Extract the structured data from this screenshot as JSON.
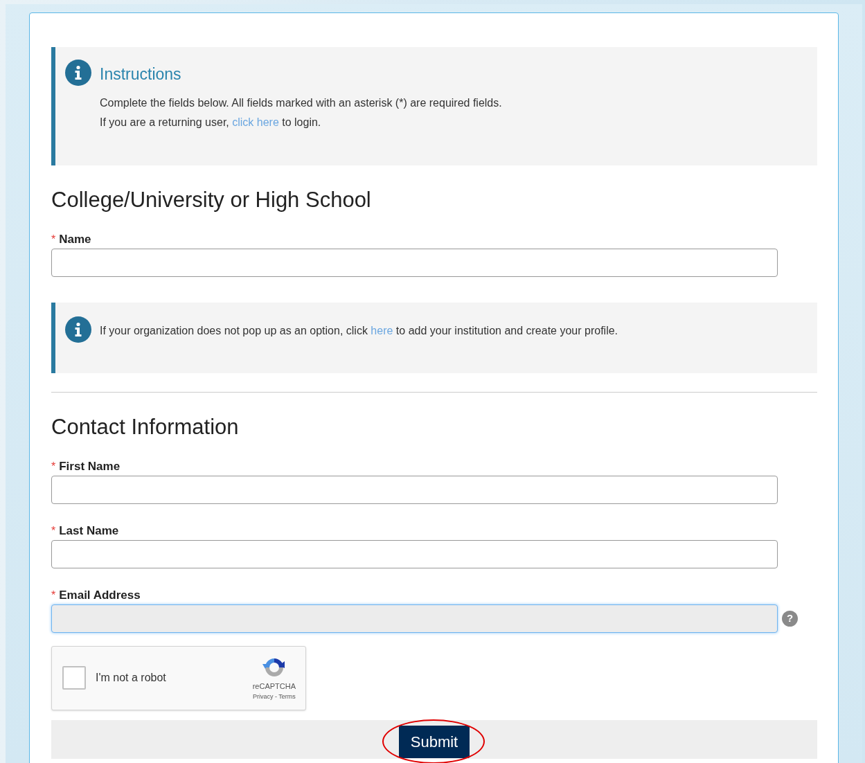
{
  "instructions": {
    "title": "Instructions",
    "lines": [
      {
        "before": "Complete the fields below. All fields marked with an asterisk (*) are required fields."
      },
      {
        "before": "If you are a returning user, ",
        "link": "click here",
        "after": " to login."
      }
    ]
  },
  "sections": [
    {
      "heading": "College/University or High School",
      "fields": [
        {
          "label": "Name",
          "required": "*",
          "focused": false
        }
      ],
      "note": {
        "before": "If your organization does not pop up as an option, click ",
        "link": "here",
        "after": " to add your institution and create your profile."
      }
    },
    {
      "heading": "Contact Information",
      "fields": [
        {
          "label": "First Name",
          "required": "*",
          "focused": false
        },
        {
          "label": "Last Name",
          "required": "*",
          "focused": false
        },
        {
          "label": "Email Address",
          "required": "*",
          "focused": true,
          "help": "?"
        }
      ]
    }
  ],
  "captcha": {
    "label": "I'm not a robot",
    "checked": false,
    "brand": "reCAPTCHA",
    "links": "Privacy - Terms"
  },
  "submit": {
    "label": "Submit",
    "circled": true
  }
}
